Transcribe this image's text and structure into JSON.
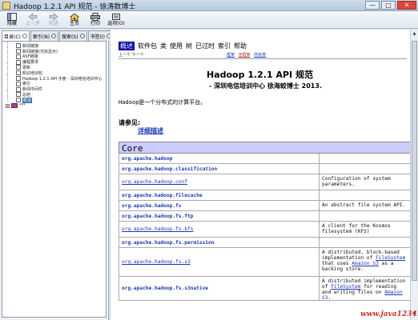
{
  "window": {
    "title": "Hadoop 1.2.1 API 规范 - 徐涛数博士",
    "buttons": [
      "—",
      "□",
      "✕"
    ]
  },
  "toolbar": [
    {
      "label": "隐藏",
      "icon": "hide-icon",
      "enabled": true
    },
    {
      "label": "上一步",
      "icon": "back-arrow-icon",
      "enabled": false
    },
    {
      "label": "前进",
      "icon": "forward-arrow-icon",
      "enabled": false
    },
    {
      "label": "主页",
      "icon": "home-icon",
      "enabled": true
    },
    {
      "label": "打印",
      "icon": "print-icon",
      "enabled": true
    },
    {
      "label": "选项(O)",
      "icon": "options-icon",
      "enabled": true
    }
  ],
  "left_tabs": [
    {
      "label": "目录(C)",
      "active": true
    },
    {
      "label": "索引(N)",
      "active": false
    },
    {
      "label": "搜索(S)",
      "active": false
    },
    {
      "label": "书签(I)",
      "active": false
    }
  ],
  "tree": [
    {
      "label": "新闻链接",
      "selected": false
    },
    {
      "label": "新闻链接(光标显示)",
      "selected": false
    },
    {
      "label": "ASF链接",
      "selected": false
    },
    {
      "label": "编程要求",
      "selected": false
    },
    {
      "label": "更新",
      "selected": false
    },
    {
      "label": "知识培训包",
      "selected": false
    },
    {
      "label": "Hadoop 1.2.1 API 手册 - 深圳电信培训中心",
      "selected": false
    },
    {
      "label": "索引",
      "selected": false
    },
    {
      "label": "新闻中间件",
      "selected": false
    },
    {
      "label": "总结",
      "selected": false
    },
    {
      "label": "概述",
      "selected": true
    },
    {
      "label": "***",
      "selected": false,
      "book": true
    }
  ],
  "content": {
    "nav": [
      "概述",
      "软件包",
      "类",
      "使用",
      "树",
      "已过时",
      "索引",
      "帮助"
    ],
    "nav_active": 0,
    "subnav": "上一个   下一个",
    "frames": [
      "框架",
      "无框架",
      "所有类"
    ],
    "title": "Hadoop 1.2.1 API 规范",
    "subtitle": "- 深圳电信培训中心 徐海蛟博士 2013.",
    "description": "Hadoop是一个分布式的计算平台。",
    "see_also": "请参见:",
    "detail_link": "详细描述",
    "table_header": "Core",
    "packages": [
      {
        "name": "org.apache.hadoop",
        "desc": "",
        "bold": true,
        "underline": false
      },
      {
        "name": "org.apache.hadoop.classification",
        "desc": "",
        "bold": true,
        "underline": false
      },
      {
        "name": "org.apache.hadoop.conf",
        "desc": "Configuration of system parameters.",
        "bold": false,
        "underline": true
      },
      {
        "name": "org.apache.hadoop.filecache",
        "desc": "",
        "bold": true,
        "underline": false
      },
      {
        "name": "org.apache.hadoop.fs",
        "desc": "An abstract file system API.",
        "bold": true,
        "underline": false
      },
      {
        "name": "org.apache.hadoop.fs.ftp",
        "desc": "",
        "bold": true,
        "underline": false
      },
      {
        "name": "org.apache.hadoop.fs.kfs",
        "desc": "A client for the Kosmos filesystem (KFS)",
        "bold": false,
        "underline": true
      },
      {
        "name": "org.apache.hadoop.fs.permission",
        "desc": "",
        "bold": true,
        "underline": false
      },
      {
        "name": "org.apache.hadoop.fs.s3",
        "desc_parts": [
          "A distributed, block-based implementation of ",
          "FileSystem",
          " that uses ",
          "Amazon S3",
          " as a backing store."
        ],
        "bold": false,
        "underline": true
      },
      {
        "name": "org.apache.hadoop.fs.s3native",
        "desc_parts": [
          "A distributed implementation of ",
          "FileSystem",
          " for reading and writing files on ",
          "Amazon S3",
          "."
        ],
        "bold": true,
        "underline": false
      }
    ]
  },
  "watermark": "www.java1234.com"
}
